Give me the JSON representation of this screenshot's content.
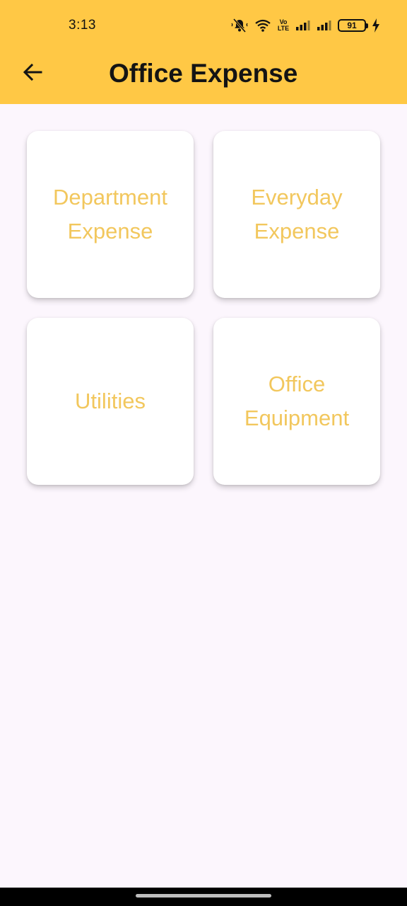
{
  "status_bar": {
    "time": "3:13",
    "volte_top": "Vo",
    "volte_bottom": "LTE",
    "battery_level": "91",
    "icons": [
      "muted-bell-icon",
      "wifi-icon",
      "volte-icon",
      "signal-icon",
      "signal-icon",
      "battery-icon",
      "charging-icon"
    ]
  },
  "app_bar": {
    "title": "Office Expense",
    "back_icon": "arrow-left-icon",
    "background_color": "#ffc845"
  },
  "cards": [
    {
      "label": "Department\nExpense"
    },
    {
      "label": "Everyday\nExpense"
    },
    {
      "label": "Utilities"
    },
    {
      "label": "Office\nEquipment"
    }
  ],
  "colors": {
    "accent": "#ffc845",
    "card_text": "#f2c75d",
    "page_background": "#fcf6fd"
  }
}
